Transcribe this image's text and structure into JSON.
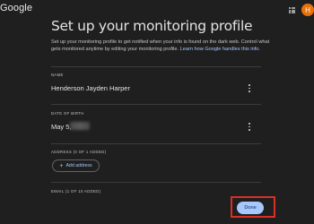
{
  "header": {
    "logo_text": "Google",
    "avatar_initial": "H"
  },
  "page": {
    "title": "Set up your monitoring profile",
    "intro": "Set up your monitoring profile to get notified when your info is found on the dark web. Control what gets monitored anytime by editing your monitoring profile. ",
    "intro_link": "Learn how Google handles this info."
  },
  "sections": {
    "name": {
      "label": "NAME",
      "value": "Henderson Jayden Harper"
    },
    "dob": {
      "label": "DATE OF BIRTH",
      "value": "May 5,"
    },
    "address": {
      "label": "ADDRESS (0 OF 1 ADDED)",
      "button_label": "Add address"
    },
    "email": {
      "label": "EMAIL (1 OF 10 ADDED)"
    }
  },
  "footer": {
    "done_label": "Done",
    "highlight_color": "#d93025"
  },
  "icons": [
    "apps-grid-icon",
    "more-vert-icon",
    "plus-icon"
  ]
}
